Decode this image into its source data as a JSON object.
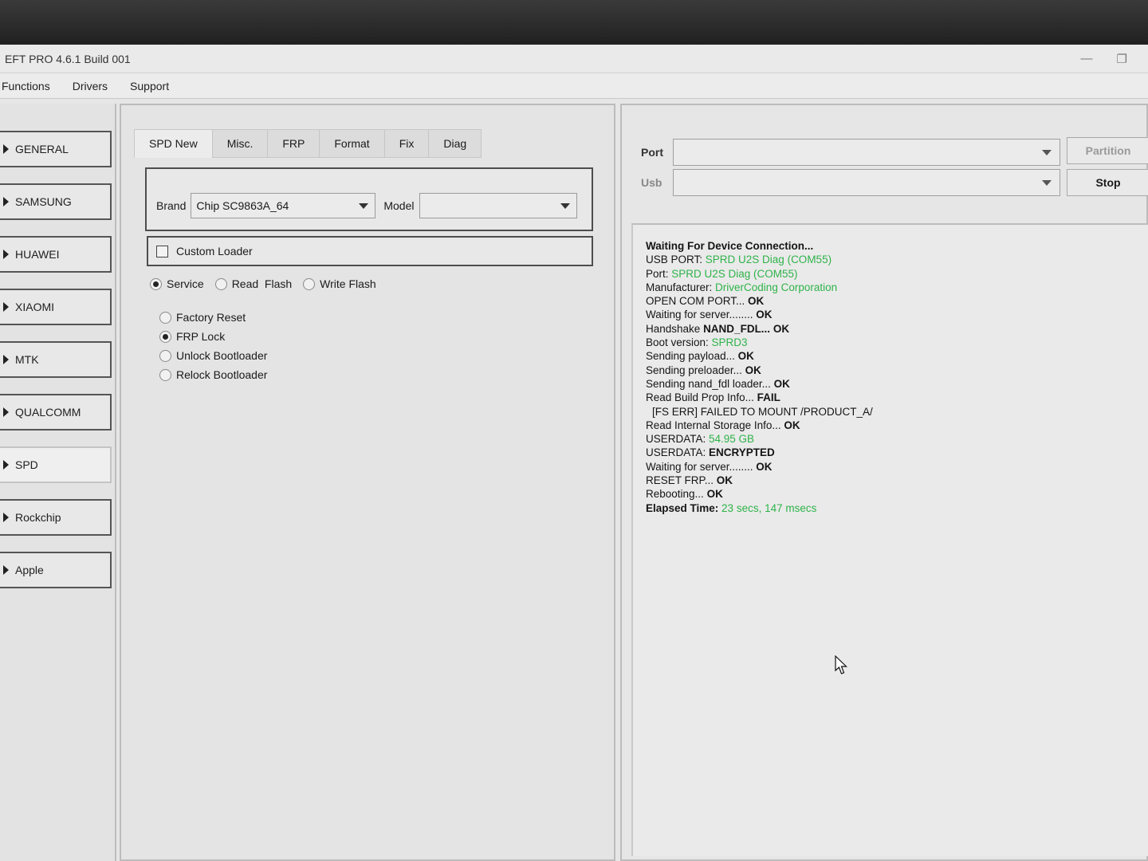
{
  "window": {
    "title": "EFT PRO 4.6.1 Build 001",
    "minimize_glyph": "—",
    "restore_glyph": "❐"
  },
  "menubar": {
    "items": [
      "Functions",
      "Drivers",
      "Support"
    ]
  },
  "sidebar": {
    "items": [
      {
        "label": "GENERAL"
      },
      {
        "label": "SAMSUNG"
      },
      {
        "label": "HUAWEI"
      },
      {
        "label": "XIAOMI"
      },
      {
        "label": "MTK"
      },
      {
        "label": "QUALCOMM"
      },
      {
        "label": "SPD"
      },
      {
        "label": "Rockchip"
      },
      {
        "label": "Apple"
      }
    ],
    "active": "SPD"
  },
  "tabs": {
    "items": [
      "SPD New",
      "Misc.",
      "FRP",
      "Format",
      "Fix",
      "Diag"
    ],
    "active": "SPD New"
  },
  "device": {
    "brand_label": "Brand",
    "brand_value": "Chip SC9863A_64",
    "model_label": "Model",
    "model_value": ""
  },
  "custom_loader": {
    "label": "Custom Loader",
    "checked": false
  },
  "mode": {
    "options": [
      "Service",
      "Read  Flash",
      "Write Flash"
    ],
    "selected": "Service"
  },
  "operations": {
    "options": [
      "Factory Reset",
      "FRP Lock",
      "Unlock Bootloader",
      "Relock Bootloader"
    ],
    "selected": "FRP Lock"
  },
  "connection": {
    "port_label": "Port",
    "port_value": "",
    "usb_label": "Usb",
    "usb_value": "",
    "partition_button": "Partition",
    "stop_button": "Stop"
  },
  "log": {
    "line01": "Waiting For Device Connection...",
    "line02_k": "USB PORT: ",
    "line02_v": "SPRD U2S Diag (COM55)",
    "line03_k": "Port: ",
    "line03_v": "SPRD U2S Diag (COM55)",
    "line04_k": "Manufacturer: ",
    "line04_v": "DriverCoding Corporation",
    "line05_k": "OPEN COM PORT... ",
    "line05_v": "OK",
    "line06_k": "Waiting for server........ ",
    "line06_v": "OK",
    "line07_k": "Handshake ",
    "line07_m": "NAND_FDL... ",
    "line07_v": "OK",
    "line08_k": "Boot version: ",
    "line08_v": "SPRD3",
    "line09_k": "Sending payload... ",
    "line09_v": "OK",
    "line10_k": "Sending preloader... ",
    "line10_v": "OK",
    "line11_k": "Sending nand_fdl loader... ",
    "line11_v": "OK",
    "line12_k": "Read Build Prop Info... ",
    "line12_v": "FAIL",
    "line13": "[FS ERR] FAILED TO MOUNT /PRODUCT_A/",
    "line14_k": "Read Internal Storage Info... ",
    "line14_v": "OK",
    "line15_k": "USERDATA: ",
    "line15_v": "54.95 GB",
    "line16_k": "USERDATA: ",
    "line16_v": "ENCRYPTED",
    "line17_k": "Waiting for server........ ",
    "line17_v": "OK",
    "line18_k": "RESET FRP... ",
    "line18_v": "OK",
    "line19_k": "Rebooting... ",
    "line19_v": "OK",
    "line20_k": "Elapsed Time: ",
    "line20_v": "23 secs, 147 msecs"
  },
  "colors": {
    "log_green": "#2fb34a",
    "window_bg": "#e6e6e6"
  },
  "icons": {
    "cursor": "mouse-pointer-icon",
    "sidebar_arrow": "triangle-right-icon",
    "combo_arrow": "chevron-down-icon"
  }
}
